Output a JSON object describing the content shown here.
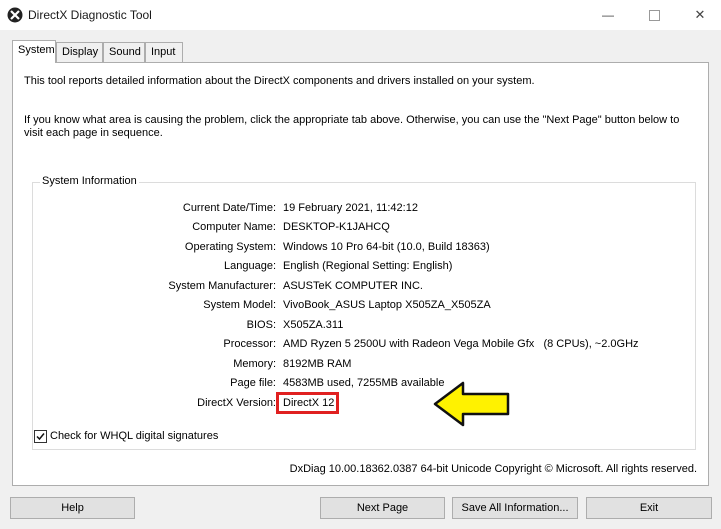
{
  "window": {
    "title": "DirectX Diagnostic Tool",
    "minimize": "—",
    "close": "✕"
  },
  "tabs": [
    {
      "label": "System",
      "active": true
    },
    {
      "label": "Display",
      "active": false
    },
    {
      "label": "Sound",
      "active": false
    },
    {
      "label": "Input",
      "active": false
    }
  ],
  "intro": {
    "line1": "This tool reports detailed information about the DirectX components and drivers installed on your system.",
    "line2": "If you know what area is causing the problem, click the appropriate tab above.  Otherwise, you can use the \"Next Page\" button below to visit each page in sequence."
  },
  "system_info": {
    "group_label": "System Information",
    "rows": [
      {
        "label": "Current Date/Time:",
        "value": "19 February 2021, 11:42:12"
      },
      {
        "label": "Computer Name:",
        "value": "DESKTOP-K1JAHCQ"
      },
      {
        "label": "Operating System:",
        "value": "Windows 10 Pro 64-bit (10.0, Build 18363)"
      },
      {
        "label": "Language:",
        "value": "English (Regional Setting: English)"
      },
      {
        "label": "System Manufacturer:",
        "value": "ASUSTeK COMPUTER INC."
      },
      {
        "label": "System Model:",
        "value": "VivoBook_ASUS Laptop X505ZA_X505ZA"
      },
      {
        "label": "BIOS:",
        "value": "X505ZA.311"
      },
      {
        "label": "Processor:",
        "value": "AMD Ryzen 5 2500U with Radeon Vega Mobile Gfx   (8 CPUs), ~2.0GHz"
      },
      {
        "label": "Memory:",
        "value": "8192MB RAM"
      },
      {
        "label": "Page file:",
        "value": "4583MB used, 7255MB available"
      },
      {
        "label": "DirectX Version:",
        "value": "DirectX 12"
      }
    ]
  },
  "whql": {
    "label": "Check for WHQL digital signatures",
    "checked": true
  },
  "footer": "DxDiag 10.00.18362.0387 64-bit Unicode  Copyright © Microsoft. All rights reserved.",
  "buttons": {
    "help": "Help",
    "next": "Next Page",
    "save": "Save All Information...",
    "exit": "Exit"
  },
  "colors": {
    "highlight": "#e02020",
    "arrow": "#fff200"
  }
}
